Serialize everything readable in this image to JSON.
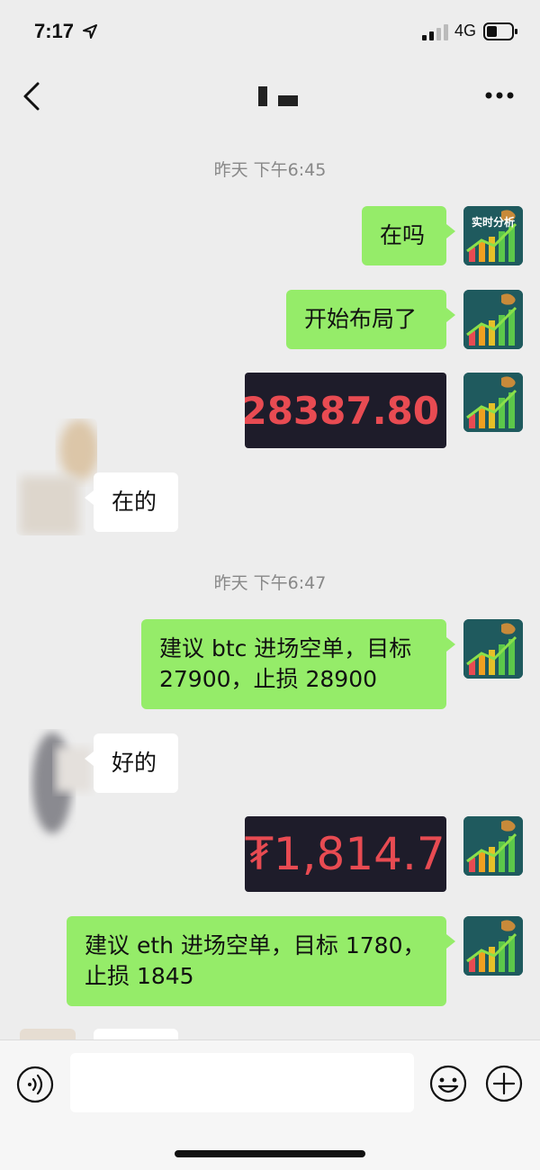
{
  "status_bar": {
    "time": "7:17",
    "network": "4G"
  },
  "nav": {
    "back": "back",
    "more": "more"
  },
  "chat": {
    "timestamps": [
      "昨天 下午6:45",
      "昨天 下午6:47"
    ],
    "messages": [
      {
        "side": "sent",
        "text": "在吗"
      },
      {
        "side": "sent",
        "text": "开始布局了"
      },
      {
        "side": "sent",
        "image_text": "28387.80"
      },
      {
        "side": "received",
        "text": "在的"
      },
      {
        "side": "sent",
        "line1": "建议 btc 进场空单，目标",
        "line2": "27900，止损 28900"
      },
      {
        "side": "received",
        "text": "好的"
      },
      {
        "side": "sent",
        "image_text": "₮1,814.7"
      },
      {
        "side": "sent",
        "line1": "建议 eth 进场空单，目标 1780，",
        "line2": "止损 1845"
      }
    ],
    "my_avatar_text": "实时分析"
  },
  "colors": {
    "sent_bubble": "#95ec69",
    "received_bubble": "#ffffff",
    "price_red": "#e84b52",
    "image_bg": "#1e1c2a"
  },
  "icons": [
    "location-arrow-icon",
    "signal-icon",
    "battery-icon",
    "back-chevron-icon",
    "more-dots-icon",
    "voice-icon",
    "emoji-icon",
    "plus-icon"
  ]
}
